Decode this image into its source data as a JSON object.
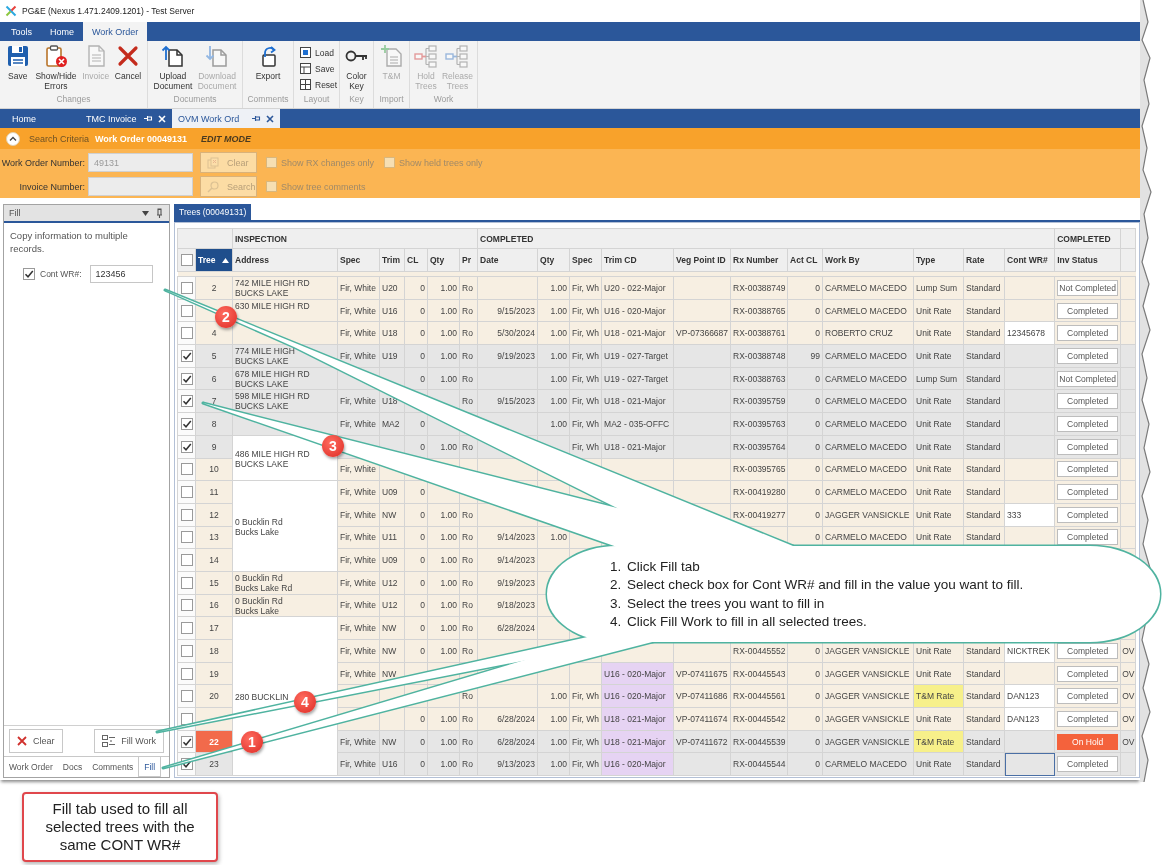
{
  "window": {
    "title": "PG&E (Nexus 1.471.2409.1201) - Test Server"
  },
  "ribbon": {
    "tabs": [
      {
        "label": "Tools",
        "selected": false
      },
      {
        "label": "Home",
        "selected": false
      },
      {
        "label": "Work Order",
        "selected": true
      }
    ],
    "groups": [
      {
        "label": "Changes",
        "kind": "large",
        "buttons": [
          {
            "label": "Save",
            "disabled": false
          },
          {
            "label": "Show/Hide Errors",
            "disabled": false
          },
          {
            "label": "Invoice",
            "disabled": true
          },
          {
            "label": "Cancel",
            "disabled": false
          }
        ]
      },
      {
        "label": "Documents",
        "kind": "large",
        "buttons": [
          {
            "label": "Upload Document",
            "disabled": false
          },
          {
            "label": "Download Document",
            "disabled": true
          }
        ]
      },
      {
        "label": "Comments",
        "kind": "large",
        "buttons": [
          {
            "label": "Export",
            "disabled": false
          }
        ]
      },
      {
        "label": "Layout",
        "kind": "small",
        "buttons": [
          {
            "label": "Load",
            "disabled": false
          },
          {
            "label": "Save",
            "disabled": false
          },
          {
            "label": "Reset",
            "disabled": false
          }
        ]
      },
      {
        "label": "Key",
        "kind": "large",
        "buttons": [
          {
            "label": "Color Key",
            "disabled": false
          }
        ]
      },
      {
        "label": "Import",
        "kind": "large",
        "buttons": [
          {
            "label": "T&M",
            "disabled": true
          }
        ]
      },
      {
        "label": "Work",
        "kind": "large",
        "buttons": [
          {
            "label": "Hold Trees",
            "disabled": true
          },
          {
            "label": "Release Trees",
            "disabled": true
          }
        ]
      }
    ]
  },
  "document_tabs": [
    {
      "label": "Home",
      "selected": false,
      "closable": false
    },
    {
      "label": "TMC Invoice",
      "selected": false,
      "closable": true
    },
    {
      "label": "OVM Work Ord",
      "selected": true,
      "closable": true
    }
  ],
  "search_header": {
    "expanded": true,
    "label": "Search Criteria",
    "work_order": "Work Order 00049131",
    "mode": "EDIT MODE"
  },
  "search_form": {
    "fields": [
      {
        "label": "Work Order Number:",
        "value": "49131",
        "disabled": true
      },
      {
        "label": "Invoice Number:",
        "disabled": true
      }
    ],
    "buttons": [
      {
        "label": "Clear",
        "disabled": true
      },
      {
        "label": "Search",
        "disabled": true
      }
    ],
    "options": [
      {
        "label": "Show RX changes only",
        "checked": false,
        "disabled": true
      },
      {
        "label": "Show held trees only",
        "checked": false,
        "disabled": true
      },
      {
        "label": "Show tree comments",
        "checked": false,
        "disabled": true
      }
    ]
  },
  "fill_panel": {
    "title": "Fill",
    "description": "Copy information to multiple records.",
    "fields": [
      {
        "label": "Cont WR#:",
        "checked": true,
        "value": "123456"
      }
    ],
    "buttons": [
      {
        "label": "Clear"
      },
      {
        "label": "Fill Work"
      }
    ],
    "tabs": [
      {
        "label": "Work Order",
        "selected": false
      },
      {
        "label": "Docs",
        "selected": false
      },
      {
        "label": "Comments",
        "selected": false
      },
      {
        "label": "Fill",
        "selected": true
      }
    ]
  },
  "grid": {
    "tab": {
      "label": "Trees (00049131)",
      "selected": true
    },
    "select_all_checked": false,
    "groups": [
      {
        "label": "INSPECTION"
      },
      {
        "label": "COMPLETED"
      },
      {
        "label": "COMPLETED"
      }
    ],
    "columns": [
      {
        "label": "Tree",
        "sorted": true
      },
      {
        "label": "Address",
        "sorted": false
      },
      {
        "label": "Spec",
        "sorted": false
      },
      {
        "label": "Trim",
        "sorted": false
      },
      {
        "label": "CL",
        "sorted": false
      },
      {
        "label": "Qty",
        "sorted": false
      },
      {
        "label": "Pr",
        "sorted": false
      },
      {
        "label": "Date",
        "sorted": false
      },
      {
        "label": "Qty",
        "sorted": false
      },
      {
        "label": "Spec",
        "sorted": false
      },
      {
        "label": "Trim CD",
        "sorted": false
      },
      {
        "label": "Veg Point ID",
        "sorted": false
      },
      {
        "label": "Rx Number",
        "sorted": false
      },
      {
        "label": "Act CL",
        "sorted": false
      },
      {
        "label": "Work By",
        "sorted": false
      },
      {
        "label": "Type",
        "sorted": false
      },
      {
        "label": "Rate",
        "sorted": false
      },
      {
        "label": "Cont WR#",
        "sorted": false
      },
      {
        "label": "Inv Status",
        "sorted": false
      }
    ],
    "rows": [
      {
        "checked": false,
        "cont_wr_selected": false,
        "tree": "2",
        "address": {
          "kind": "single",
          "text": "742 MILE HIGH RD\nBUCKS LAKE"
        },
        "spec": "Fir, White",
        "trim": "U20",
        "cl": "0",
        "qty": "1.00",
        "pr": "Ro",
        "completed_qty": "1.00",
        "completed_spec": "Fir, Wh",
        "trim_cd": "U20 - 022-Major",
        "rx_number": "RX-00388749",
        "act_cl": "0",
        "work_by": "CARMELO MACEDO",
        "type": "Lump Sum",
        "rate": "Standard",
        "inv_status": {
          "text": "Not Completed",
          "kind": "normal"
        }
      },
      {
        "checked": false,
        "cont_wr_selected": false,
        "address": {
          "kind": "single",
          "text": "630 MILE HIGH RD"
        },
        "spec": "Fir, White",
        "trim": "U16",
        "cl": "0",
        "qty": "1.00",
        "pr": "Ro",
        "date": "9/15/2023",
        "completed_qty": "1.00",
        "completed_spec": "Fir, Wh",
        "trim_cd": "U16 - 020-Major",
        "rx_number": "RX-00388765",
        "act_cl": "0",
        "work_by": "CARMELO MACEDO",
        "type": "Unit Rate",
        "rate": "Standard",
        "inv_status": {
          "text": "Completed",
          "kind": "normal"
        }
      },
      {
        "checked": false,
        "cont_wr_selected": false,
        "tree": "4",
        "address": {
          "kind": "single"
        },
        "spec": "Fir, White",
        "trim": "U18",
        "cl": "0",
        "qty": "1.00",
        "pr": "Ro",
        "date": "5/30/2024",
        "completed_qty": "1.00",
        "completed_spec": "Fir, Wh",
        "trim_cd": "U18 - 021-Major",
        "veg_point_id": "VP-07366687",
        "rx_number": "RX-00388761",
        "act_cl": "0",
        "work_by": "ROBERTO CRUZ",
        "type": "Unit Rate",
        "rate": "Standard",
        "cont_wr": "12345678",
        "inv_status": {
          "text": "Completed",
          "kind": "normal"
        }
      },
      {
        "checked": true,
        "cont_wr_selected": false,
        "tree": "5",
        "address": {
          "kind": "single",
          "text": "774 MILE HIGH\nBUCKS LAKE"
        },
        "spec": "Fir, White",
        "trim": "U19",
        "cl": "0",
        "qty": "1.00",
        "pr": "Ro",
        "date": "9/19/2023",
        "completed_qty": "1.00",
        "completed_spec": "Fir, Wh",
        "trim_cd": "U19 - 027-Target",
        "rx_number": "RX-00388748",
        "act_cl": "99",
        "work_by": "CARMELO MACEDO",
        "type": "Unit Rate",
        "rate": "Standard",
        "inv_status": {
          "text": "Completed",
          "kind": "normal"
        }
      },
      {
        "checked": true,
        "cont_wr_selected": false,
        "tree": "6",
        "address": {
          "kind": "single",
          "text": "678 MILE HIGH RD\nBUCKS LAKE"
        },
        "cl": "0",
        "qty": "1.00",
        "pr": "Ro",
        "completed_qty": "1.00",
        "completed_spec": "Fir, Wh",
        "trim_cd": "U19 - 027-Target",
        "rx_number": "RX-00388763",
        "act_cl": "0",
        "work_by": "CARMELO MACEDO",
        "type": "Lump Sum",
        "rate": "Standard",
        "inv_status": {
          "text": "Not Completed",
          "kind": "normal"
        }
      },
      {
        "checked": true,
        "cont_wr_selected": false,
        "tree": "7",
        "address": {
          "kind": "single",
          "text": "598 MILE HIGH RD\nBUCKS LAKE"
        },
        "spec": "Fir, White",
        "trim": "U18",
        "pr": "Ro",
        "date": "9/15/2023",
        "completed_qty": "1.00",
        "completed_spec": "Fir, Wh",
        "trim_cd": "U18 - 021-Major",
        "rx_number": "RX-00395759",
        "act_cl": "0",
        "work_by": "CARMELO MACEDO",
        "type": "Unit Rate",
        "rate": "Standard",
        "inv_status": {
          "text": "Completed",
          "kind": "normal"
        }
      },
      {
        "checked": true,
        "cont_wr_selected": false,
        "tree": "8",
        "address": {
          "kind": "single"
        },
        "spec": "Fir, White",
        "trim": "MA2",
        "cl": "0",
        "completed_qty": "1.00",
        "completed_spec": "Fir, Wh",
        "trim_cd": "MA2 - 035-OFFC",
        "rx_number": "RX-00395763",
        "act_cl": "0",
        "work_by": "CARMELO MACEDO",
        "type": "Unit Rate",
        "rate": "Standard",
        "inv_status": {
          "text": "Completed",
          "kind": "normal"
        }
      },
      {
        "checked": true,
        "cont_wr_selected": false,
        "tree": "9",
        "address": {
          "kind": "group_start",
          "text": "486 MILE HIGH RD\nBUCKS LAKE"
        },
        "cl": "0",
        "qty": "1.00",
        "pr": "Ro",
        "completed_spec": "Fir, Wh",
        "trim_cd": "U18 - 021-Major",
        "rx_number": "RX-00395764",
        "act_cl": "0",
        "work_by": "CARMELO MACEDO",
        "type": "Unit Rate",
        "rate": "Standard",
        "inv_status": {
          "text": "Completed",
          "kind": "normal"
        }
      },
      {
        "checked": false,
        "cont_wr_selected": false,
        "tree": "10",
        "address": {
          "kind": "group_cont"
        },
        "spec": "Fir, White",
        "rx_number": "RX-00395765",
        "act_cl": "0",
        "work_by": "CARMELO MACEDO",
        "type": "Unit Rate",
        "rate": "Standard",
        "inv_status": {
          "text": "Completed",
          "kind": "normal"
        }
      },
      {
        "checked": false,
        "cont_wr_selected": false,
        "tree": "11",
        "address": {
          "kind": "group_start",
          "text": "0 Bucklin Rd\nBucks Lake"
        },
        "spec": "Fir, White",
        "trim": "U09",
        "cl": "0",
        "rx_number": "RX-00419280",
        "act_cl": "0",
        "work_by": "CARMELO MACEDO",
        "type": "Unit Rate",
        "rate": "Standard",
        "inv_status": {
          "text": "Completed",
          "kind": "normal"
        }
      },
      {
        "checked": false,
        "cont_wr_selected": false,
        "tree": "12",
        "address": {
          "kind": "group_cont"
        },
        "spec": "Fir, White",
        "trim": "NW",
        "cl": "0",
        "qty": "1.00",
        "pr": "Ro",
        "rx_number": "RX-00419277",
        "act_cl": "0",
        "work_by": "JAGGER VANSICKLE",
        "type": "Unit Rate",
        "rate": "Standard",
        "cont_wr": "333",
        "inv_status": {
          "text": "Completed",
          "kind": "normal"
        }
      },
      {
        "checked": false,
        "cont_wr_selected": false,
        "tree": "13",
        "address": {
          "kind": "group_cont"
        },
        "spec": "Fir, White",
        "trim": "U11",
        "cl": "0",
        "qty": "1.00",
        "pr": "Ro",
        "date": "9/14/2023",
        "completed_qty": "1.00",
        "act_cl": "0",
        "work_by": "CARMELO MACEDO",
        "type": "Unit Rate",
        "rate": "Standard",
        "inv_status": {
          "text": "Completed",
          "kind": "normal"
        }
      },
      {
        "checked": false,
        "tree": "14",
        "address": {
          "kind": "group_cont"
        },
        "spec": "Fir, White",
        "trim": "U09",
        "cl": "0",
        "qty": "1.00",
        "pr": "Ro",
        "date": "9/14/2023"
      },
      {
        "checked": false,
        "tree": "15",
        "address": {
          "kind": "single",
          "text": "0 Bucklin Rd\nBucks Lake Rd"
        },
        "spec": "Fir, White",
        "trim": "U12",
        "cl": "0",
        "qty": "1.00",
        "pr": "Ro",
        "date": "9/19/2023"
      },
      {
        "checked": false,
        "tree": "16",
        "address": {
          "kind": "single",
          "text": "0 Bucklin Rd\nBucks Lake"
        },
        "spec": "Fir, White",
        "trim": "U12",
        "cl": "0",
        "qty": "1.00",
        "pr": "Ro",
        "date": "9/18/2023"
      },
      {
        "checked": false,
        "tree": "17",
        "address": {
          "kind": "group_start",
          "text": "280 BUCKLIN"
        },
        "spec": "Fir, White",
        "trim": "NW",
        "cl": "0",
        "qty": "1.00",
        "pr": "Ro",
        "date": "6/28/2024"
      },
      {
        "checked": false,
        "cont_wr_selected": false,
        "tree": "18",
        "address": {
          "kind": "group_cont"
        },
        "spec": "Fir, White",
        "trim": "NW",
        "cl": "0",
        "qty": "1.00",
        "pr": "Ro",
        "rx_number": "RX-00445552",
        "act_cl": "0",
        "work_by": "JAGGER VANSICKLE",
        "type": "Unit Rate",
        "rate": "Standard",
        "cont_wr": "NICKTREK",
        "inv_status": {
          "text": "Completed",
          "kind": "normal"
        },
        "column_21": "OV"
      },
      {
        "checked": false,
        "cont_wr_selected": false,
        "tree": "19",
        "address": {
          "kind": "group_cont"
        },
        "spec": "Fir, White",
        "trim": "NW",
        "trim_cd": {
          "text": "U16 - 020-Major",
          "color": "#e6d3f3"
        },
        "veg_point_id": "VP-07411675",
        "rx_number": "RX-00445543",
        "act_cl": "0",
        "work_by": "JAGGER VANSICKLE",
        "type": "Unit Rate",
        "rate": "Standard",
        "inv_status": {
          "text": "Completed",
          "kind": "normal"
        },
        "column_21": "OV"
      },
      {
        "checked": false,
        "cont_wr_selected": false,
        "tree": "20",
        "address": {
          "kind": "group_cont"
        },
        "pr": "Ro",
        "completed_qty": "1.00",
        "completed_spec": "Fir, Wh",
        "trim_cd": {
          "text": "U16 - 020-Major",
          "color": "#e6d3f3"
        },
        "veg_point_id": "VP-07411686",
        "rx_number": "RX-00445561",
        "act_cl": "0",
        "work_by": "JAGGER VANSICKLE",
        "type": {
          "text": "T&M Rate",
          "color": "#f7f08a"
        },
        "rate": "Standard",
        "cont_wr": "DAN123",
        "inv_status": {
          "text": "Completed",
          "kind": "normal"
        },
        "column_21": "OV"
      },
      {
        "checked": false,
        "cont_wr_selected": false,
        "address": {
          "kind": "group_cont"
        },
        "cl": "0",
        "qty": "1.00",
        "pr": "Ro",
        "date": "6/28/2024",
        "completed_qty": "1.00",
        "completed_spec": "Fir, Wh",
        "trim_cd": {
          "text": "U18 - 021-Major",
          "color": "#e6d3f3"
        },
        "veg_point_id": "VP-07411674",
        "rx_number": "RX-00445542",
        "act_cl": "0",
        "work_by": "JAGGER VANSICKLE",
        "type": "Unit Rate",
        "rate": "Standard",
        "cont_wr": "DAN123",
        "inv_status": {
          "text": "Completed",
          "kind": "normal"
        },
        "column_21": "OV"
      },
      {
        "checked": true,
        "cont_wr_selected": false,
        "tree": "22",
        "address": {
          "kind": "group_cont"
        },
        "spec": "Fir, White",
        "trim": "NW",
        "cl": "0",
        "qty": "1.00",
        "pr": "Ro",
        "date": "6/28/2024",
        "completed_qty": "1.00",
        "completed_spec": "Fir, Wh",
        "trim_cd": {
          "text": "U18 - 021-Major",
          "color": "#e6d3f3"
        },
        "veg_point_id": "VP-07411672",
        "rx_number": "RX-00445539",
        "act_cl": "0",
        "work_by": "JAGGER VANSICKLE",
        "type": {
          "text": "T&M Rate",
          "color": "#f7f08a"
        },
        "rate": "Standard",
        "inv_status": {
          "text": "On Hold",
          "kind": "hold"
        },
        "column_21": "OV"
      },
      {
        "checked": true,
        "cont_wr_selected": true,
        "tree": "23",
        "address": {
          "kind": "group_cont"
        },
        "spec": "Fir, White",
        "trim": "U16",
        "cl": "0",
        "qty": "1.00",
        "pr": "Ro",
        "date": "9/13/2023",
        "completed_qty": "1.00",
        "completed_spec": "Fir, Wh",
        "trim_cd": {
          "text": "U16 - 020-Major",
          "color": "#e6d3f3"
        },
        "rx_number": "RX-00445544",
        "act_cl": "0",
        "work_by": "CARMELO MACEDO",
        "type": "Unit Rate",
        "rate": "Standard",
        "inv_status": {
          "text": "Completed",
          "kind": "normal"
        }
      }
    ]
  },
  "callout": {
    "steps": [
      {
        "number": "1.",
        "text": "Click Fill tab"
      },
      {
        "number": "2.",
        "text": "Select check box for Cont WR# and fill in the value you want to fill."
      },
      {
        "number": "3.",
        "text": "Select the trees you want to fill in"
      },
      {
        "number": "4.",
        "text": "Click Fill Work to fill in all selected trees."
      }
    ],
    "markers": [
      "2",
      "3",
      "4",
      "1"
    ]
  },
  "note": {
    "text": "Fill tab used to fill all selected trees with the same CONT WR#"
  }
}
